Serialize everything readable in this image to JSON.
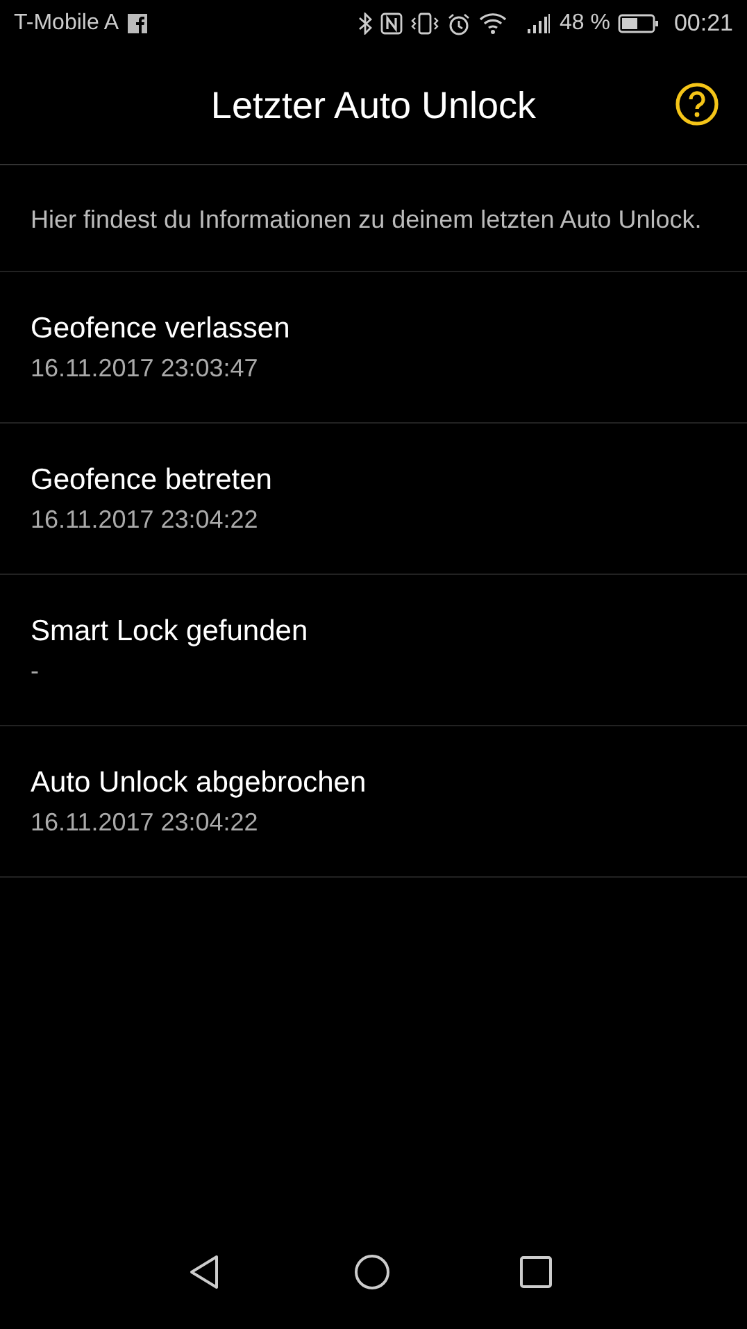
{
  "status_bar": {
    "carrier": "T-Mobile A",
    "battery": "48 %",
    "time": "00:21"
  },
  "header": {
    "title": "Letzter Auto Unlock"
  },
  "description": "Hier findest du Informationen zu deinem letzten Auto Unlock.",
  "events": [
    {
      "title": "Geofence verlassen",
      "value": "16.11.2017 23:03:47"
    },
    {
      "title": "Geofence betreten",
      "value": "16.11.2017 23:04:22"
    },
    {
      "title": "Smart Lock gefunden",
      "value": "-"
    },
    {
      "title": "Auto Unlock abgebrochen",
      "value": "16.11.2017 23:04:22"
    }
  ]
}
